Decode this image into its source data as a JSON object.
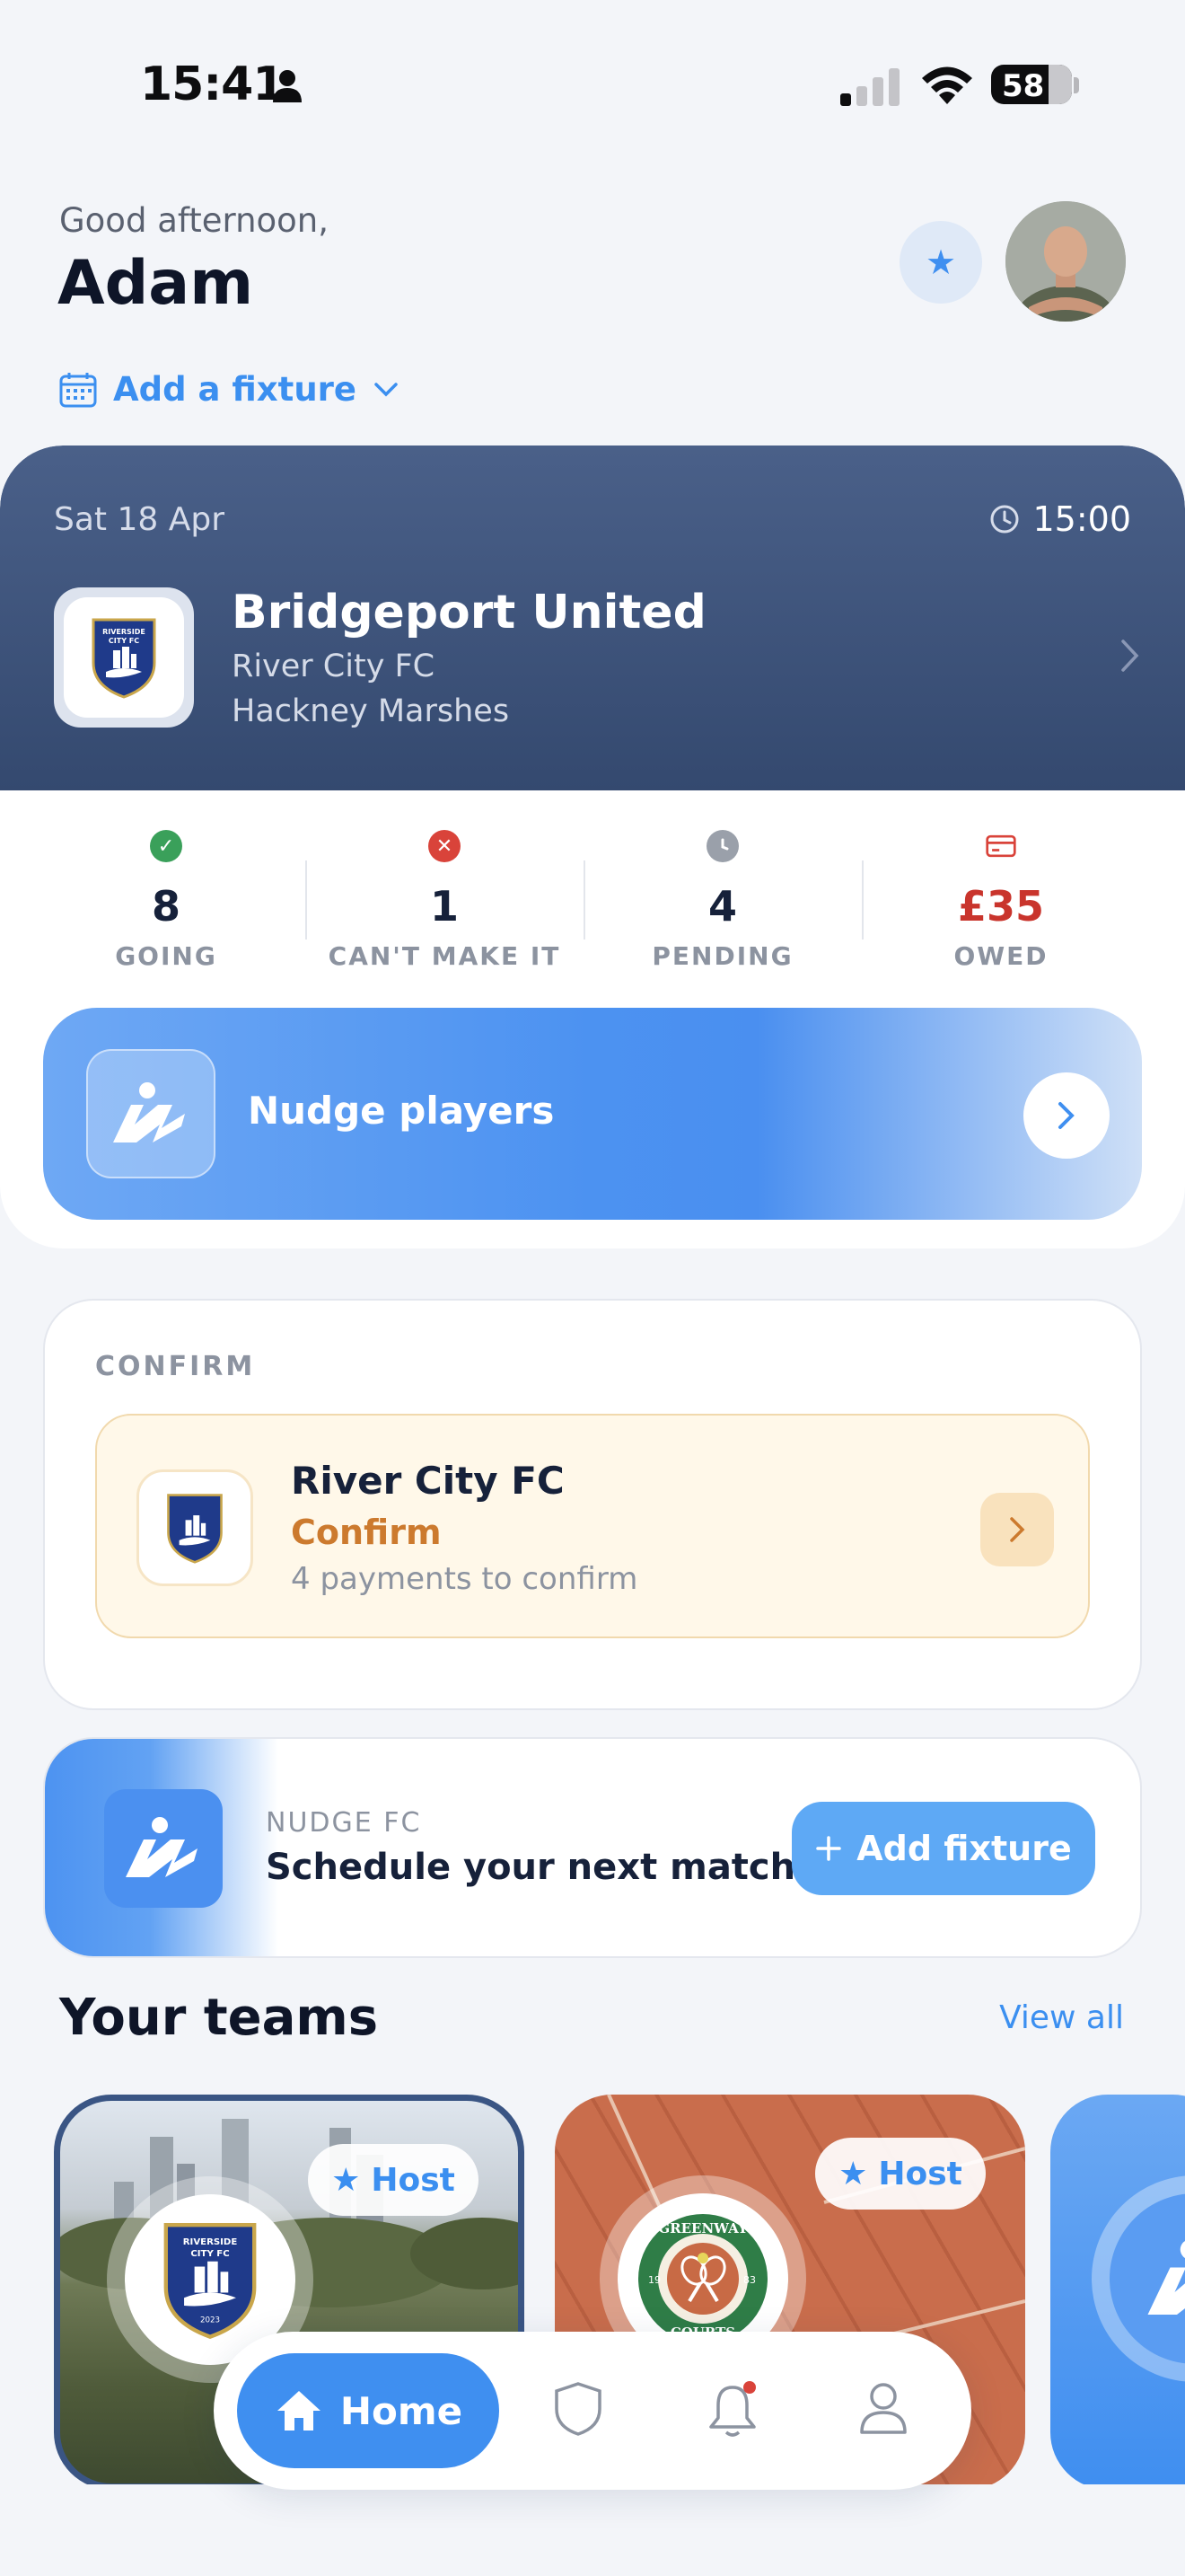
{
  "status_bar": {
    "time": "15:41",
    "battery": "58"
  },
  "header": {
    "greeting": "Good afternoon,",
    "name": "Adam",
    "add_fixture_label": "Add a fixture"
  },
  "fixture": {
    "date": "Sat 18 Apr",
    "time": "15:00",
    "opponent": "Bridgeport United",
    "team": "River City FC",
    "venue": "Hackney Marshes",
    "stats": [
      {
        "value": "8",
        "label": "GOING",
        "color": "#3aa05a"
      },
      {
        "value": "1",
        "label": "CAN'T MAKE IT",
        "color": "#d9433a"
      },
      {
        "value": "4",
        "label": "PENDING",
        "color": "#9aa0aa"
      },
      {
        "value": "£35",
        "label": "OWED",
        "color": "#c9342c"
      }
    ],
    "nudge_label": "Nudge players"
  },
  "confirm": {
    "title": "CONFIRM",
    "team": "River City FC",
    "status": "Confirm",
    "description": "4 payments to confirm"
  },
  "promo": {
    "brand": "NUDGE FC",
    "text": "Schedule your next match",
    "button_label": "Add fixture"
  },
  "teams": {
    "title": "Your teams",
    "view_all": "View all",
    "cards": [
      {
        "host_label": "Host",
        "badge_text": "RIVERSIDE CITY FC",
        "badge_year": "2023"
      },
      {
        "host_label": "Host",
        "badge_text": "GREENWAY COURTS",
        "badge_year_left": "19",
        "badge_year_right": "83"
      },
      {
        "host_label": ""
      }
    ]
  },
  "tabbar": {
    "home_label": "Home"
  },
  "colors": {
    "accent": "#3f8ff0",
    "navy": "#34496f",
    "confirm_orange": "#cc7a2e",
    "owed_red": "#c9342c"
  }
}
